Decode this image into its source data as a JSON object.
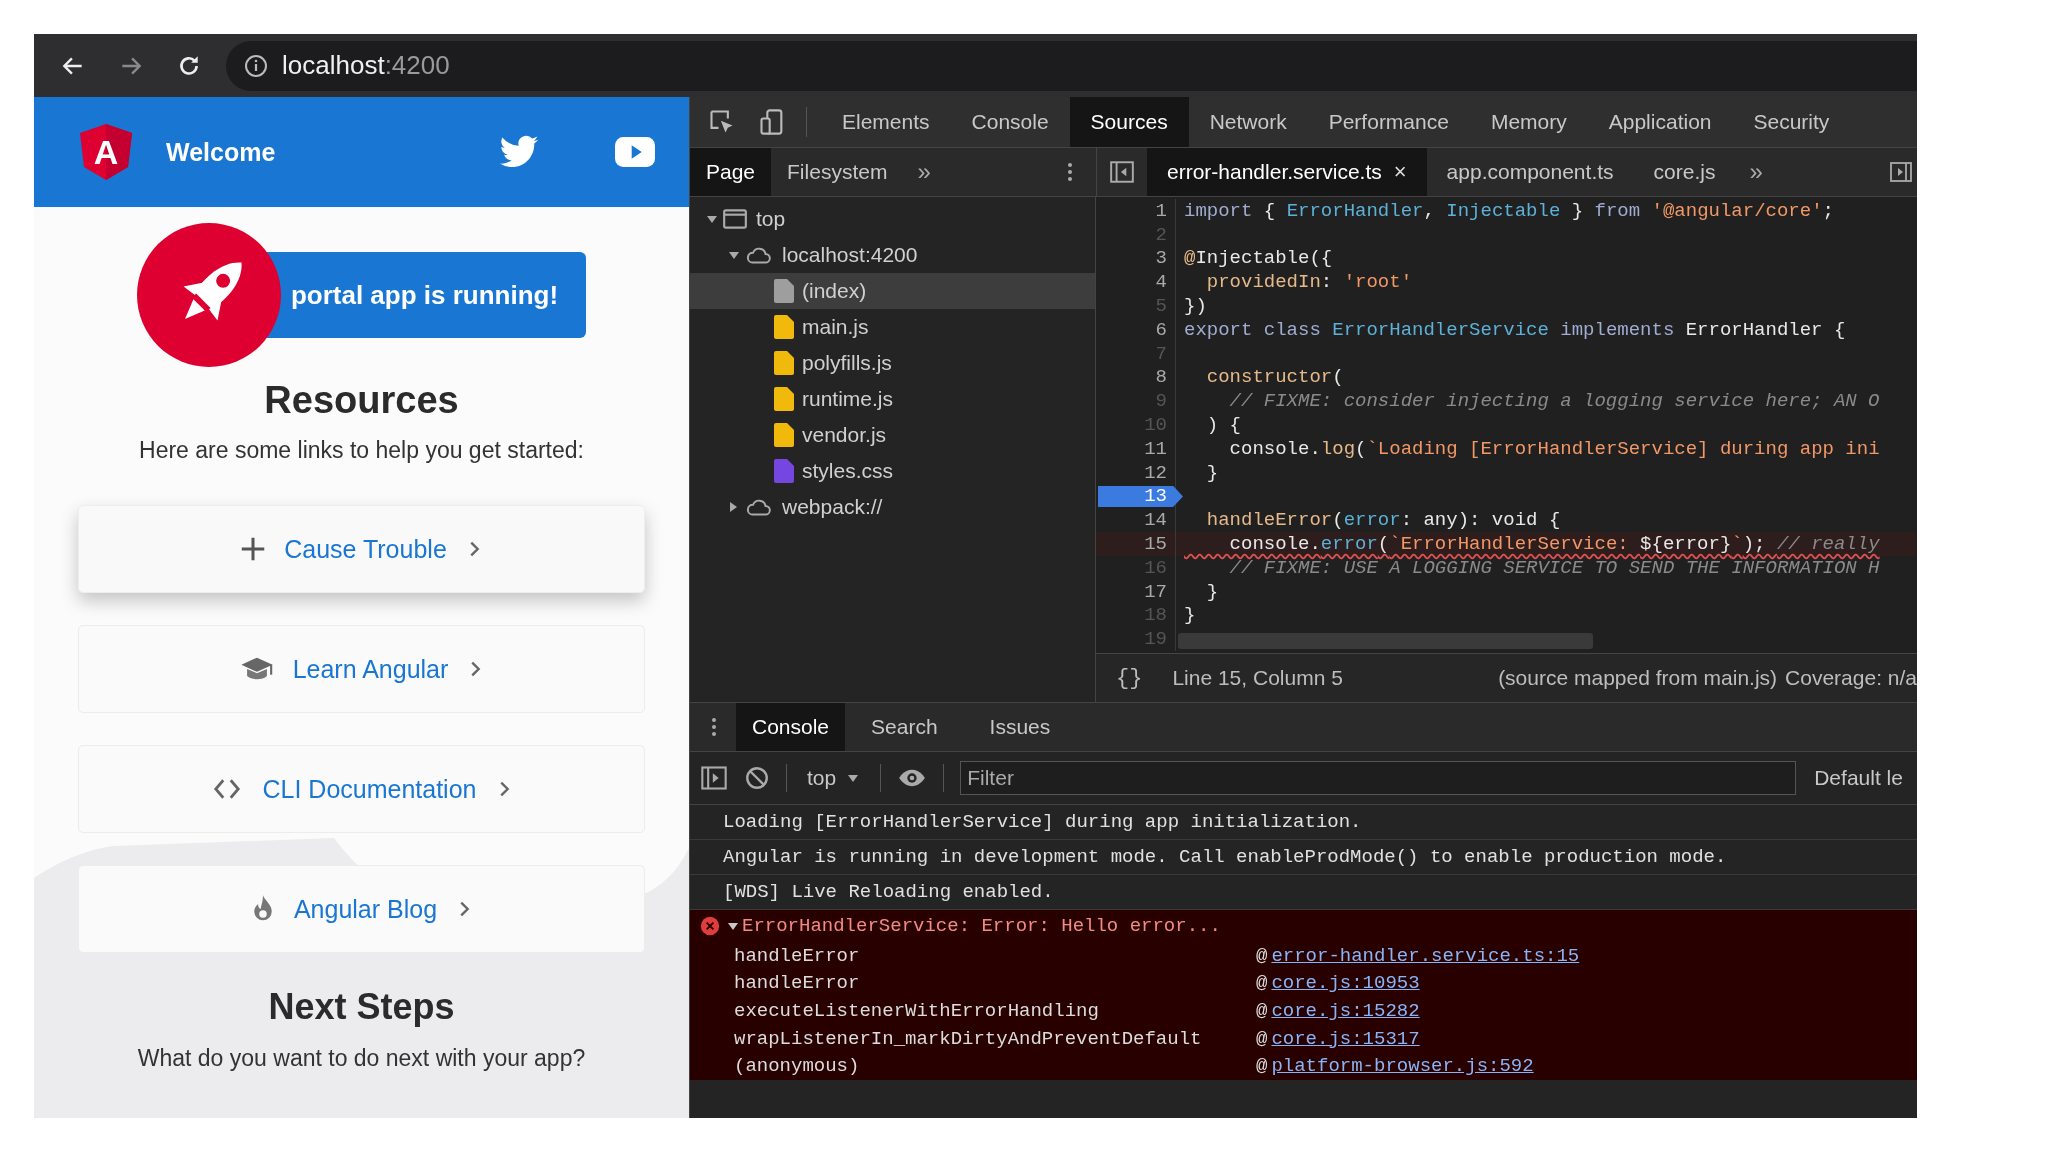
{
  "browser": {
    "address": {
      "host": "localhost",
      "port": ":4200"
    }
  },
  "app": {
    "logo_letter": "A",
    "title": "Welcome",
    "banner": "portal app is running!",
    "resources_title": "Resources",
    "resources_subtitle": "Here are some links to help you get started:",
    "cards": [
      {
        "kind": "plus",
        "label": "Cause Trouble",
        "elevated": true
      },
      {
        "kind": "graduation",
        "label": "Learn Angular",
        "elevated": false
      },
      {
        "kind": "code",
        "label": "CLI Documentation",
        "elevated": false
      },
      {
        "kind": "fire",
        "label": "Angular Blog",
        "elevated": false
      }
    ],
    "next_title": "Next Steps",
    "next_subtitle": "What do you want to do next with your app?"
  },
  "devtools": {
    "tabs": [
      {
        "label": "Elements",
        "selected": false
      },
      {
        "label": "Console",
        "selected": false
      },
      {
        "label": "Sources",
        "selected": true
      },
      {
        "label": "Network",
        "selected": false
      },
      {
        "label": "Performance",
        "selected": false
      },
      {
        "label": "Memory",
        "selected": false
      },
      {
        "label": "Application",
        "selected": false
      },
      {
        "label": "Security",
        "selected": false
      }
    ],
    "navigator_tabs": [
      {
        "label": "Page",
        "selected": true
      },
      {
        "label": "Filesystem",
        "selected": false
      }
    ],
    "navigator_more": "»",
    "file_tabs": [
      {
        "label": "error-handler.service.ts",
        "selected": true,
        "close": "×"
      },
      {
        "label": "app.component.ts",
        "selected": false
      },
      {
        "label": "core.js",
        "selected": false
      }
    ],
    "file_tabs_more": "»",
    "tree": [
      {
        "label": "top",
        "kind": "frame",
        "expanded": true,
        "selected": false,
        "children": [
          {
            "label": "localhost:4200",
            "kind": "origin",
            "expanded": true,
            "selected": false,
            "children": [
              {
                "label": "(index)",
                "kind": "file",
                "color": "#9e9e9e",
                "selected": true
              },
              {
                "label": "main.js",
                "kind": "file",
                "color": "#f0b90b",
                "selected": false
              },
              {
                "label": "polyfills.js",
                "kind": "file",
                "color": "#f0b90b",
                "selected": false
              },
              {
                "label": "runtime.js",
                "kind": "file",
                "color": "#f0b90b",
                "selected": false
              },
              {
                "label": "vendor.js",
                "kind": "file",
                "color": "#f0b90b",
                "selected": false
              },
              {
                "label": "styles.css",
                "kind": "file",
                "color": "#7646e0",
                "selected": false
              }
            ]
          },
          {
            "label": "webpack://",
            "kind": "origin",
            "expanded": false,
            "selected": false
          }
        ]
      }
    ],
    "code": [
      {
        "no": "1",
        "mapped": true,
        "breakpoint": false,
        "error": false,
        "tokens": [
          {
            "t": "import",
            "kind": "keyword"
          },
          {
            "t": " { ",
            "kind": "plain"
          },
          {
            "t": "ErrorHandler",
            "kind": "type"
          },
          {
            "t": ", ",
            "kind": "plain"
          },
          {
            "t": "Injectable",
            "kind": "type"
          },
          {
            "t": " } ",
            "kind": "plain"
          },
          {
            "t": "from",
            "kind": "keyword"
          },
          {
            "t": " '@angular/core'",
            "kind": "string"
          },
          {
            "t": ";",
            "kind": "plain"
          }
        ]
      },
      {
        "no": "2",
        "mapped": false,
        "breakpoint": false,
        "error": false
      },
      {
        "no": "3",
        "mapped": true,
        "breakpoint": false,
        "error": false,
        "tokens": [
          {
            "t": "@",
            "kind": "function"
          },
          {
            "t": "Injectable({",
            "kind": "plain"
          }
        ]
      },
      {
        "no": "4",
        "mapped": true,
        "breakpoint": false,
        "error": false,
        "tokens": [
          {
            "t": "  providedIn",
            "kind": "function"
          },
          {
            "t": ": ",
            "kind": "plain"
          },
          {
            "t": "'root'",
            "kind": "string"
          }
        ]
      },
      {
        "no": "5",
        "mapped": false,
        "breakpoint": false,
        "error": false,
        "tokens": [
          {
            "t": "})",
            "kind": "plain"
          }
        ]
      },
      {
        "no": "6",
        "mapped": true,
        "breakpoint": false,
        "error": false,
        "tokens": [
          {
            "t": "export class ",
            "kind": "keyword"
          },
          {
            "t": "ErrorHandlerService",
            "kind": "type"
          },
          {
            "t": " implements",
            "kind": "keyword"
          },
          {
            "t": " ErrorHandler {",
            "kind": "plain"
          }
        ]
      },
      {
        "no": "7",
        "mapped": false,
        "breakpoint": false,
        "error": false
      },
      {
        "no": "8",
        "mapped": true,
        "breakpoint": false,
        "error": false,
        "tokens": [
          {
            "t": "  constructor",
            "kind": "function"
          },
          {
            "t": "(",
            "kind": "plain"
          }
        ]
      },
      {
        "no": "9",
        "mapped": false,
        "breakpoint": false,
        "error": false,
        "tokens": [
          {
            "t": "    // FIXME: consider injecting a logging service here; AN O",
            "kind": "comment"
          }
        ]
      },
      {
        "no": "10",
        "mapped": false,
        "breakpoint": false,
        "error": false,
        "tokens": [
          {
            "t": "  ) {",
            "kind": "plain"
          }
        ]
      },
      {
        "no": "11",
        "mapped": true,
        "breakpoint": false,
        "error": false,
        "tokens": [
          {
            "t": "    console.",
            "kind": "plain"
          },
          {
            "t": "log",
            "kind": "function"
          },
          {
            "t": "(",
            "kind": "plain"
          },
          {
            "t": "`Loading [ErrorHandlerService] during app ini",
            "kind": "string"
          }
        ]
      },
      {
        "no": "12",
        "mapped": true,
        "breakpoint": false,
        "error": false,
        "tokens": [
          {
            "t": "  }",
            "kind": "plain"
          }
        ]
      },
      {
        "no": "13",
        "mapped": true,
        "breakpoint": true,
        "error": false
      },
      {
        "no": "14",
        "mapped": true,
        "breakpoint": false,
        "error": false,
        "tokens": [
          {
            "t": "  handleError",
            "kind": "function"
          },
          {
            "t": "(",
            "kind": "plain"
          },
          {
            "t": "error",
            "kind": "type"
          },
          {
            "t": ": any): void {",
            "kind": "plain"
          }
        ]
      },
      {
        "no": "15",
        "mapped": true,
        "breakpoint": false,
        "error": true,
        "tokens": [
          {
            "t": "    console.",
            "kind": "plain"
          },
          {
            "t": "error",
            "kind": "type"
          },
          {
            "t": "(",
            "kind": "plain"
          },
          {
            "t": "`ErrorHandlerService: ",
            "kind": "string"
          },
          {
            "t": "${error}",
            "kind": "plain"
          },
          {
            "t": "`",
            "kind": "string"
          },
          {
            "t": "); ",
            "kind": "plain"
          },
          {
            "t": "// really",
            "kind": "comment"
          }
        ]
      },
      {
        "no": "16",
        "mapped": false,
        "breakpoint": false,
        "error": false,
        "tokens": [
          {
            "t": "    // FIXME: USE A LOGGING SERVICE TO SEND THE INFORMATION H",
            "kind": "comment"
          }
        ]
      },
      {
        "no": "17",
        "mapped": true,
        "breakpoint": false,
        "error": false,
        "tokens": [
          {
            "t": "  }",
            "kind": "plain"
          }
        ]
      },
      {
        "no": "18",
        "mapped": false,
        "breakpoint": false,
        "error": false,
        "tokens": [
          {
            "t": "}",
            "kind": "plain"
          }
        ]
      },
      {
        "no": "19",
        "mapped": false,
        "breakpoint": false,
        "error": false
      }
    ],
    "status": {
      "format": "{}",
      "position": "Line 15, Column 5",
      "source_prefix": "(source mapped from ",
      "source_link": "main.js",
      "source_suffix": ")",
      "coverage": "Coverage: n/a"
    },
    "drawer_tabs": [
      {
        "label": "Console",
        "selected": true
      },
      {
        "label": "Search",
        "selected": false
      },
      {
        "label": "Issues",
        "selected": false
      }
    ],
    "console": {
      "context": "top",
      "filter_placeholder": "Filter",
      "levels": "Default le",
      "messages": [
        {
          "kind": "log",
          "text": "Loading [ErrorHandlerService] during app initialization."
        },
        {
          "kind": "log",
          "text": "Angular is running in development mode. Call enableProdMode() to enable production mode."
        },
        {
          "kind": "log",
          "text": "[WDS] Live Reloading enabled."
        },
        {
          "kind": "error",
          "text": "ErrorHandlerService: Error: Hello error...",
          "expanded": true,
          "frames": [
            {
              "function": "handleError",
              "at": "@",
              "link": "error-handler.service.ts:15"
            },
            {
              "function": "handleError",
              "at": "@",
              "link": "core.js:10953"
            },
            {
              "function": "executeListenerWithErrorHandling",
              "at": "@",
              "link": "core.js:15282"
            },
            {
              "function": "wrapListenerIn_markDirtyAndPreventDefault",
              "at": "@",
              "link": "core.js:15317"
            },
            {
              "function": "(anonymous)",
              "at": "@",
              "link": "platform-browser.js:592"
            }
          ]
        }
      ]
    }
  }
}
